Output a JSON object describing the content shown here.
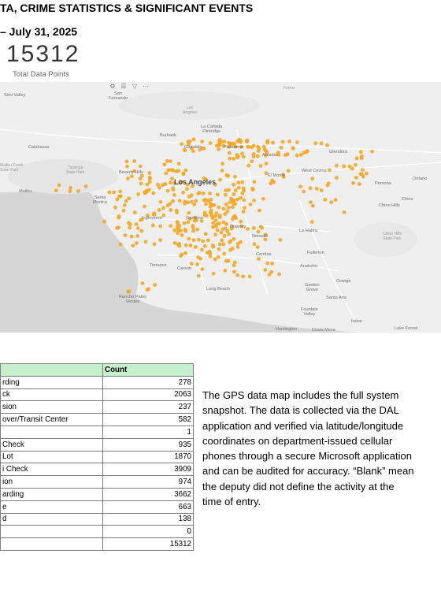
{
  "header": {
    "title": "TA, CRIME STATISTICS & SIGNIFICANT EVENTS",
    "date_range": "– July 31, 2025"
  },
  "kpi": {
    "value": "15312",
    "label": "Total Data Points"
  },
  "map": {
    "toolbar_icons": [
      "gear-icon",
      "list-icon",
      "filter-icon",
      "more-icon"
    ],
    "point_color": "#f5a623",
    "places": {
      "simi_valley": "Simi Valley",
      "san_fernando": "San\nFernando",
      "los_angeles_forest": "Los\nAngeles",
      "calabasas": "Calabasas",
      "burbank": "Burbank",
      "la_canada": "La Cañada\nFlintridge",
      "glendale": "Glendale",
      "pasadena": "Pasadena",
      "arcadia": "Arcadia",
      "glendora": "Glendora",
      "malibu_creek": "Malibu Creek\nState Park",
      "topanga": "Topanga\nState Park",
      "beverly_hills": "Beverly Hills",
      "los_angeles": "Los Angeles",
      "el_monte": "El Monte",
      "west_covina": "West Covina",
      "pomona": "Pomona",
      "ontario": "Ontario",
      "malibu": "Malibu",
      "santa_monica": "Santa\nMonica",
      "inglewood": "Inglewood",
      "chino": "Chino",
      "chino_hills": "Chino Hills",
      "gardena": "Gardena",
      "downey": "Downey",
      "la_habra": "La Habra",
      "chino_hills_park": "Chino Hills\nState Park",
      "norwalk": "Norwalk",
      "fullerton": "Fullerton",
      "torrance": "Torrance",
      "carson": "Carson",
      "cerritos": "Cerritos",
      "anaheim": "Anaheim",
      "orange": "Orange",
      "garden_grove": "Garden\nGrove",
      "long_beach": "Long Beach",
      "rancho_palos_verdes": "Rancho Palos\nVerdes",
      "santa_ana": "Santa Ana",
      "fountain_valley": "Fountain\nValley",
      "irvine": "Irvine",
      "huntington": "Huntington",
      "costa_mesa": "Costa Mesa",
      "lake_forest": "Lake Forest",
      "forest": "Forest"
    }
  },
  "activity_table": {
    "columns": [
      "",
      "Count"
    ],
    "rows": [
      {
        "label": "rding",
        "count": "278"
      },
      {
        "label": "ck",
        "count": "2063"
      },
      {
        "label": "sion",
        "count": "237"
      },
      {
        "label": "over/Transit Center",
        "count": "582"
      },
      {
        "label": "",
        "count": "1"
      },
      {
        "label": "Check",
        "count": "935"
      },
      {
        "label": "Lot",
        "count": "1870"
      },
      {
        "label": "i Check",
        "count": "3909"
      },
      {
        "label": "ion",
        "count": "974"
      },
      {
        "label": "arding",
        "count": "3662"
      },
      {
        "label": "e",
        "count": "663"
      },
      {
        "label": "d",
        "count": "138"
      },
      {
        "label": "",
        "count": "0"
      },
      {
        "label": "",
        "count": "15312"
      }
    ]
  },
  "description": {
    "lines": [
      "The GPS data map includes the full system",
      "snapshot. The data is collected via the DAL",
      "application and verified via latitude/longitude",
      "coordinates on department-issued cellular",
      "phones through a secure Microsoft application",
      "and can be audited for accuracy. “Blank” mean",
      "the deputy did not define the activity at the",
      "time of entry."
    ]
  }
}
